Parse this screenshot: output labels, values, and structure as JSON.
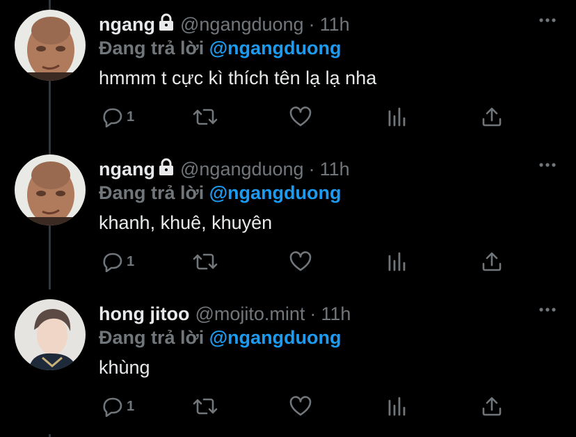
{
  "tweets": [
    {
      "name": "ngang",
      "handle": "@ngangduong",
      "separator": "·",
      "time": "11h",
      "replying_prefix": "Đang trả lời",
      "replying_to": "@ngangduong",
      "text": "hmmm t cực kì thích tên lạ lạ nha",
      "reply_count": "1",
      "locked": true
    },
    {
      "name": "ngang",
      "handle": "@ngangduong",
      "separator": "·",
      "time": "11h",
      "replying_prefix": "Đang trả lời",
      "replying_to": "@ngangduong",
      "text": "khanh, khuê, khuyên",
      "reply_count": "1",
      "locked": true
    },
    {
      "name": "hong jitoo",
      "handle": "@mojito.mint",
      "separator": "·",
      "time": "11h",
      "replying_prefix": "Đang trả lời",
      "replying_to": "@ngangduong",
      "text": "khùng",
      "reply_count": "1",
      "locked": false
    }
  ],
  "icons": [
    "lock-icon",
    "more-icon",
    "reply-icon",
    "retweet-icon",
    "like-icon",
    "views-icon",
    "share-icon"
  ],
  "colors": {
    "background": "#000000",
    "text": "#e7e9ea",
    "muted": "#71767b",
    "mention": "#1d9bf0"
  }
}
